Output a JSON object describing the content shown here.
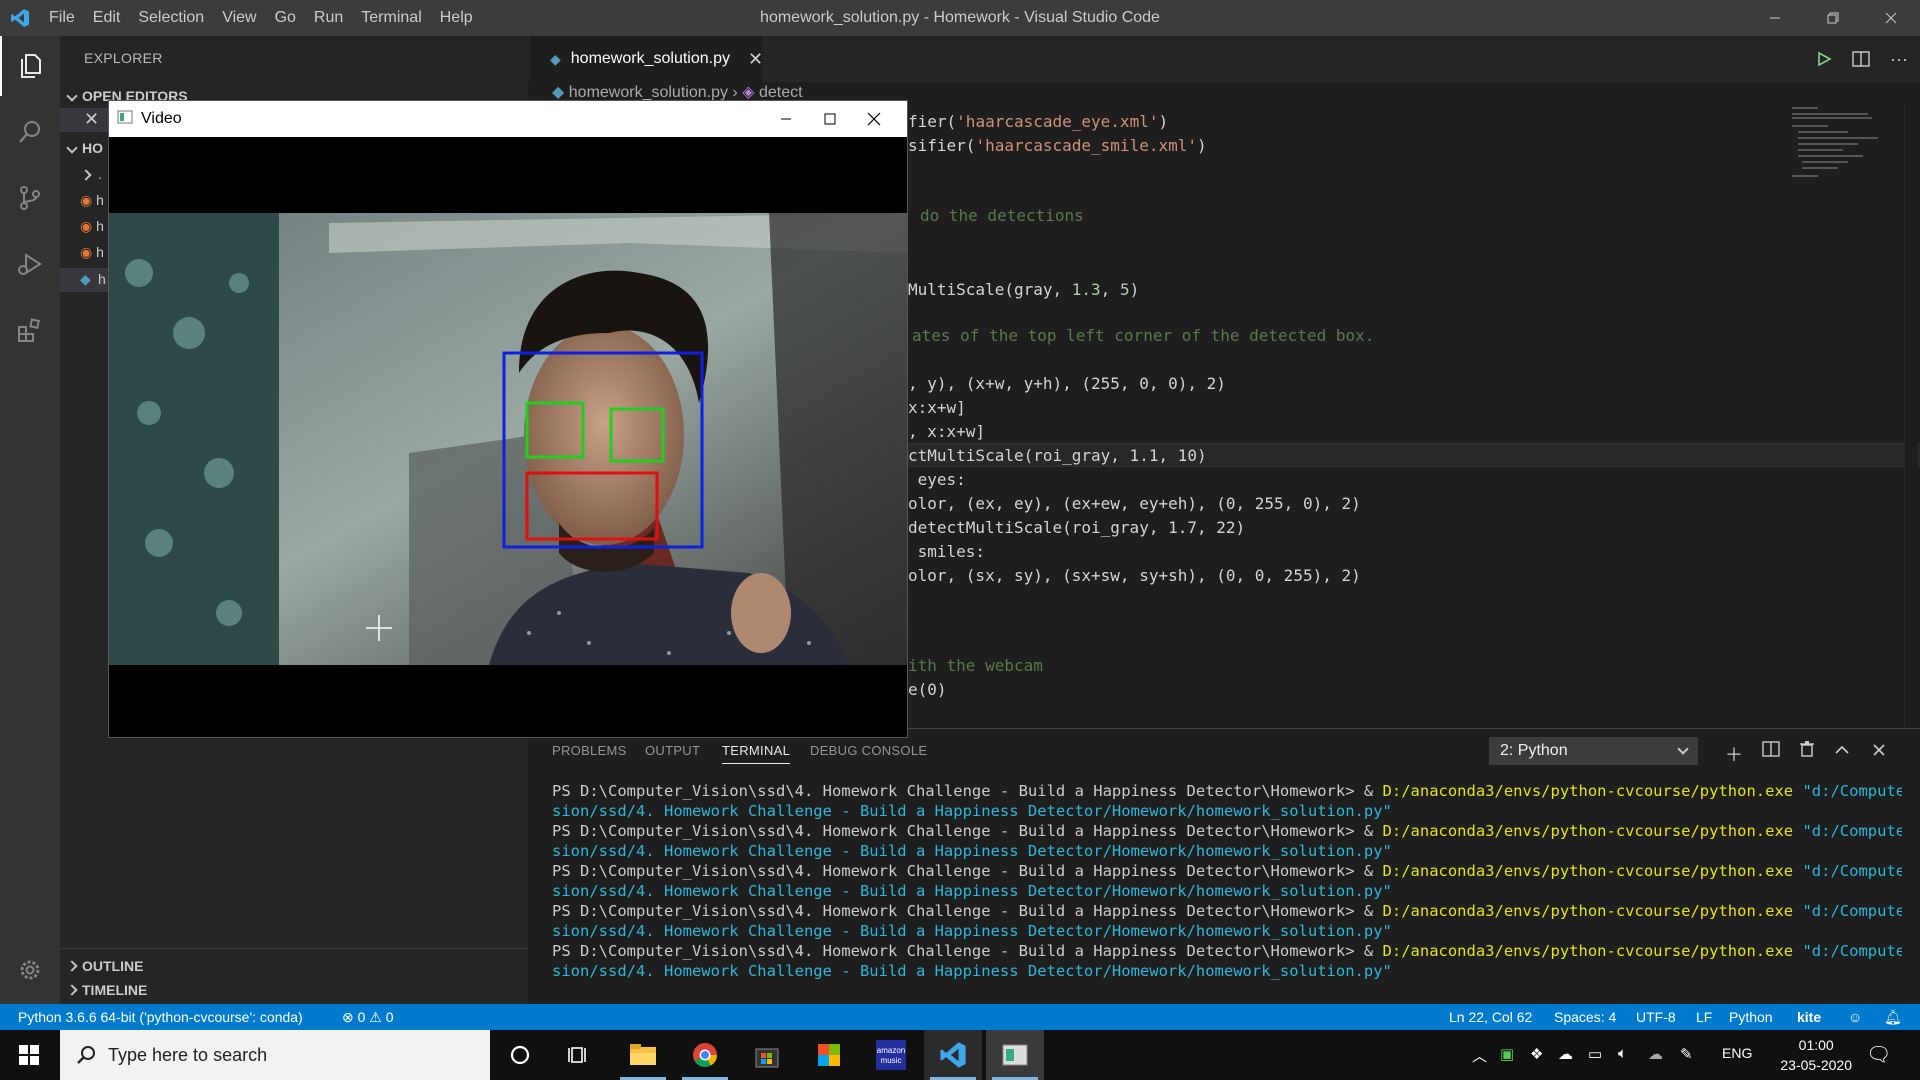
{
  "window": {
    "title": "homework_solution.py - Homework - Visual Studio Code",
    "menu": [
      "File",
      "Edit",
      "Selection",
      "View",
      "Go",
      "Run",
      "Terminal",
      "Help"
    ]
  },
  "sidebar": {
    "header": "EXPLORER",
    "open_editors": "OPEN EDITORS",
    "folder": "HO",
    "files": [
      ".",
      "h",
      "h",
      "h",
      "h"
    ],
    "outline": "OUTLINE",
    "timeline": "TIMELINE"
  },
  "editor": {
    "tab_label": "homework_solution.py",
    "breadcrumb_file": "homework_solution.py",
    "breadcrumb_symbol": "detect",
    "code_lines": [
      {
        "pre": "fier(",
        "str": "'haarcascade_eye.xml'",
        "post": ")"
      },
      {
        "pre": "sifier(",
        "str": "'haarcascade_smile.xml'",
        "post": ")"
      },
      {
        "comment": "do the detections"
      },
      {
        "pre": "MultiScale(gray, ",
        "num1": "1.3",
        "mid": ", ",
        "num2": "5",
        "post": ")"
      },
      {
        "comment": "ates of the top left corner of the detected box."
      },
      {
        "text": ", y), (x+w, y+h), (255, 0, 0), 2)"
      },
      {
        "text": "x:x+w]"
      },
      {
        "text": ", x:x+w]"
      },
      {
        "text": "ctMultiScale(roi_gray, 1.1, 10)"
      },
      {
        "text": " eyes:"
      },
      {
        "text": "olor, (ex, ey), (ex+ew, ey+eh), (0, 255, 0), 2)"
      },
      {
        "text": "detectMultiScale(roi_gray, 1.7, 22)"
      },
      {
        "text": " smiles:"
      },
      {
        "text": "olor, (sx, sy), (sx+sw, sy+sh), (0, 0, 255), 2)"
      },
      {
        "comment": "ith the webcam"
      },
      {
        "text": "e(0)"
      }
    ]
  },
  "panel": {
    "tabs": [
      "PROBLEMS",
      "OUTPUT",
      "TERMINAL",
      "DEBUG CONSOLE"
    ],
    "terminal_select": "2: Python",
    "prompt": "PS D:\\Computer_Vision\\ssd\\4. Homework Challenge - Build a Happiness Detector\\Homework> & ",
    "exe": "D:/anaconda3/envs/python-cvcourse/python.exe",
    "arg1": " \"d:/Computer_Vi",
    "arg2": "sion/ssd/4. Homework Challenge - Build a Happiness Detector/Homework/homework_solution.py\"",
    "repeat": 5
  },
  "statusbar": {
    "interpreter": "Python 3.6.6 64-bit ('python-cvcourse': conda)",
    "problems": "⊗ 0 ⚠ 0",
    "position": "Ln 22, Col 62",
    "spaces": "Spaces: 4",
    "encoding": "UTF-8",
    "eol": "LF",
    "language": "Python",
    "kite": "kite"
  },
  "video_window": {
    "title": "Video"
  },
  "taskbar": {
    "search_placeholder": "Type here to search",
    "lang": "ENG",
    "time": "01:00",
    "date": "23-05-2020"
  },
  "colors": {
    "accent": "#007acc",
    "face_box": "#1020e0",
    "eye_box": "#20d020",
    "smile_box": "#e01010"
  }
}
